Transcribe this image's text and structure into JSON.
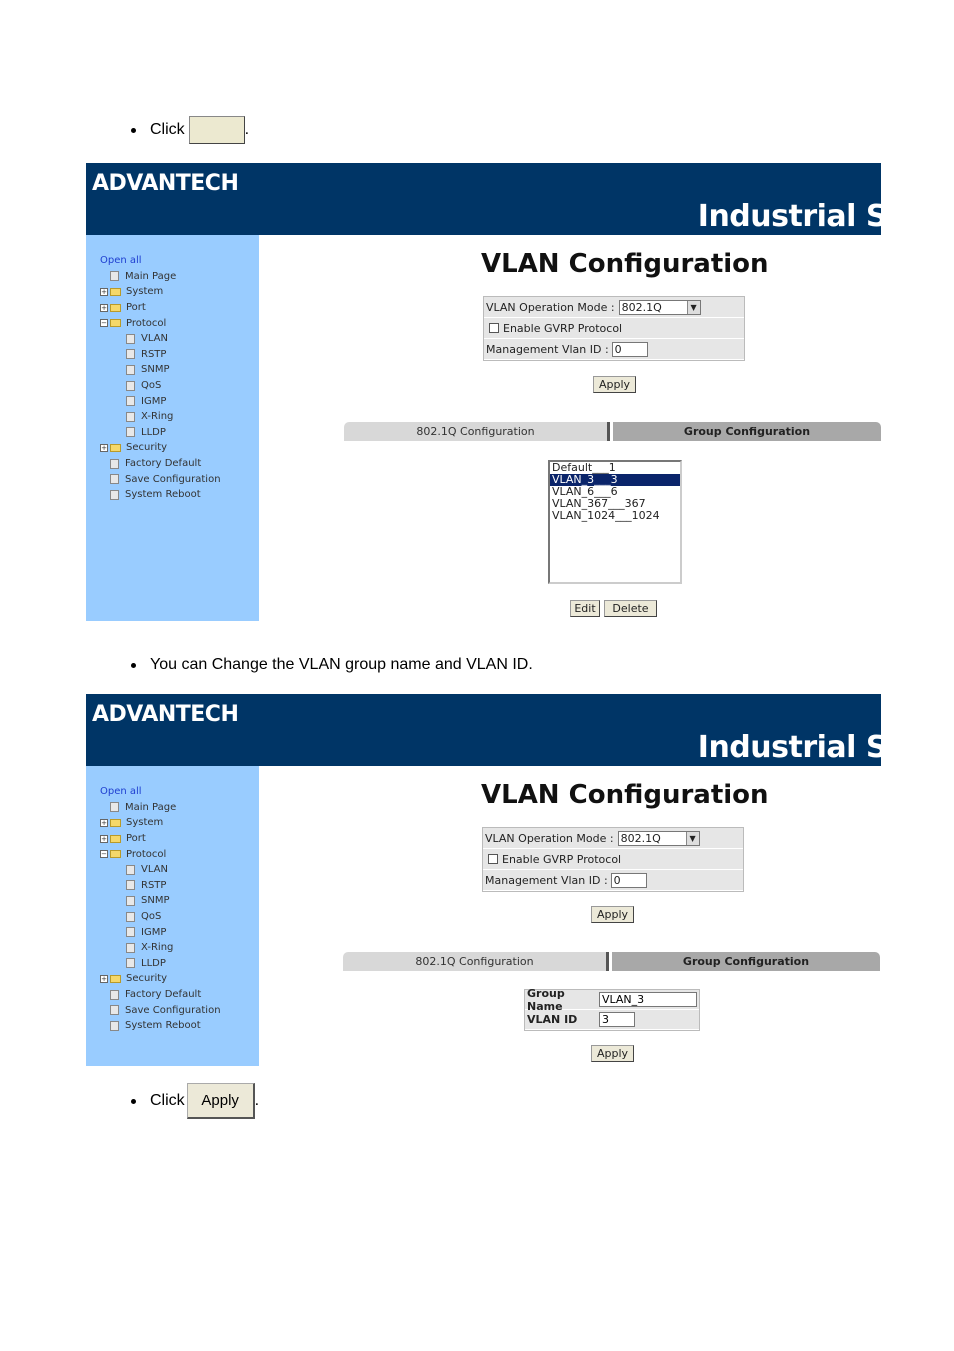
{
  "doc": {
    "step1": {
      "prefix": "Click",
      "button_label": "",
      "suffix": "."
    },
    "step2": {
      "text": "You can Change the VLAN group name and VLAN ID."
    },
    "step3": {
      "prefix": "Click",
      "button_label": "Apply",
      "suffix": "."
    }
  },
  "header": {
    "logo": "ADVANTECH",
    "brand": "Industrial S"
  },
  "sidebar": {
    "open_all": "Open all",
    "items": [
      "Main Page",
      "System",
      "Port",
      "Protocol",
      "VLAN",
      "RSTP",
      "SNMP",
      "QoS",
      "IGMP",
      "X-Ring",
      "LLDP",
      "Security",
      "Factory Default",
      "Save Configuration",
      "System Reboot"
    ]
  },
  "vlan": {
    "title": "VLAN Configuration",
    "mode_label": "VLAN Operation Mode :",
    "mode_value": "802.1Q",
    "gvrp_label": "Enable GVRP Protocol",
    "mgmt_label": "Management Vlan ID :",
    "mgmt_value": "0",
    "apply": "Apply",
    "tab_8021q": "802.1Q Configuration",
    "tab_group": "Group Configuration",
    "list": [
      "Default___1",
      "VLAN_3___3",
      "VLAN_6___6",
      "VLAN_367___367",
      "VLAN_1024___1024"
    ],
    "edit": "Edit",
    "delete": "Delete",
    "group_name_label": "Group Name",
    "group_name_value": "VLAN_3",
    "vlan_id_label": "VLAN ID",
    "vlan_id_value": "3"
  }
}
